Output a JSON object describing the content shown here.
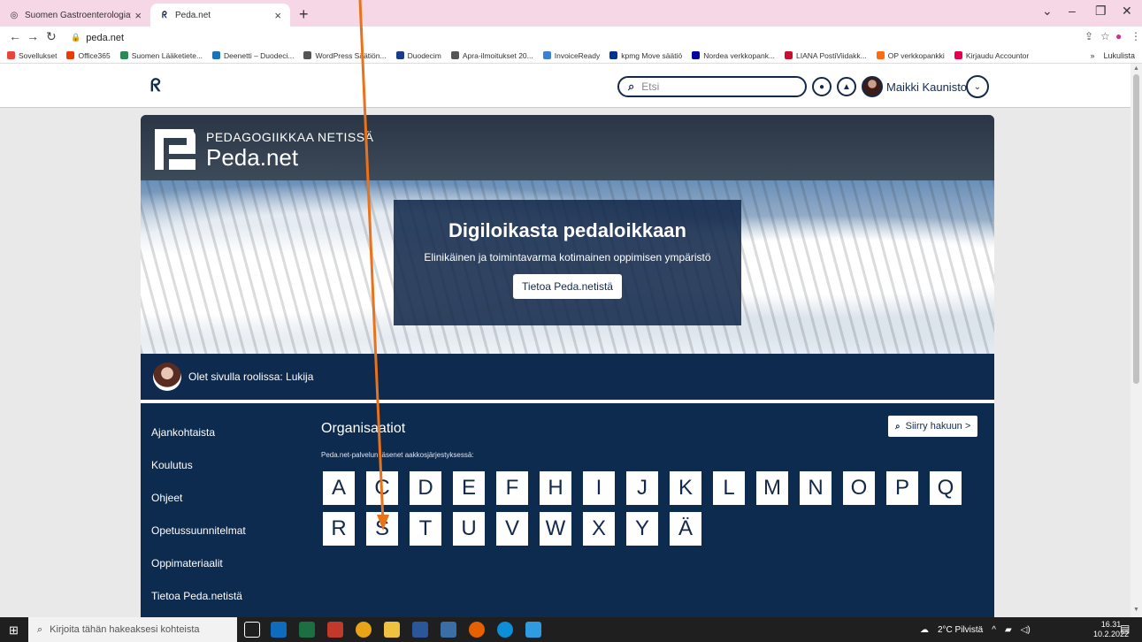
{
  "browser": {
    "tabs": [
      {
        "title": "Suomen Gastroenterologiayhdist",
        "active": false
      },
      {
        "title": "Peda.net",
        "active": true
      }
    ],
    "new_tab_symbol": "+",
    "url": "peda.net",
    "bookmarks": [
      {
        "label": "Sovellukset",
        "color": "#e8453c"
      },
      {
        "label": "Office365",
        "color": "#eb3c00"
      },
      {
        "label": "Suomen Lääketiete...",
        "color": "#2a8a56"
      },
      {
        "label": "Deenetti – Duodeci...",
        "color": "#1a73b8"
      },
      {
        "label": "WordPress Säätiön...",
        "color": "#555555"
      },
      {
        "label": "Duodecim",
        "color": "#1a3a8c"
      },
      {
        "label": "Apra-ilmoitukset 20...",
        "color": "#555555"
      },
      {
        "label": "InvoiceReady",
        "color": "#3d7fd1"
      },
      {
        "label": "kpmg Move säätiö",
        "color": "#00338d"
      },
      {
        "label": "Nordea verkkopank...",
        "color": "#0000a0"
      },
      {
        "label": "LIANA PostiViidakk...",
        "color": "#c8102e"
      },
      {
        "label": "OP verkkopankki",
        "color": "#ff6a10"
      },
      {
        "label": "Kirjaudu Accountor",
        "color": "#e4004f"
      }
    ],
    "bookmarks_overflow": "»",
    "reading_list": "Lukulista"
  },
  "site": {
    "search_placeholder": "Etsi",
    "user_name": "Maikki Kaunisto",
    "brand_tagline": "PEDAGOGIIKKAA NETISSÄ",
    "brand_name": "Peda.net",
    "hero_title": "Digiloikasta pedaloikkaan",
    "hero_subtitle": "Elinikäinen ja toimintavarma kotimainen oppimisen ympäristö",
    "hero_button": "Tietoa Peda.netistä",
    "role_text": "Olet sivulla roolissa: Lukija",
    "nav": [
      "Ajankohtaista",
      "Koulutus",
      "Ohjeet",
      "Opetussuunnitelmat",
      "Oppimateriaalit",
      "Tietoa Peda.netistä"
    ],
    "org_title": "Organisaatiot",
    "org_subtitle": "Peda.net-palvelun jäsenet aakkosjärjestyksessä:",
    "goto_search": "Siirry hakuun >",
    "letters_row1": [
      "A",
      "C",
      "D",
      "E",
      "F",
      "H",
      "I",
      "J",
      "K",
      "L",
      "M",
      "N",
      "O",
      "P",
      "Q"
    ],
    "letters_row2": [
      "R",
      "S",
      "T",
      "U",
      "V",
      "W",
      "X",
      "Y",
      "Ä"
    ]
  },
  "taskbar": {
    "search_placeholder": "Kirjoita tähän hakeaksesi kohteista",
    "weather": "2°C Pilvistä",
    "time": "16.31",
    "date": "10.2.2022"
  },
  "colors": {
    "navy": "#13294b",
    "annotation": "#e8731a",
    "tab_bar": "#f6d7e6"
  }
}
